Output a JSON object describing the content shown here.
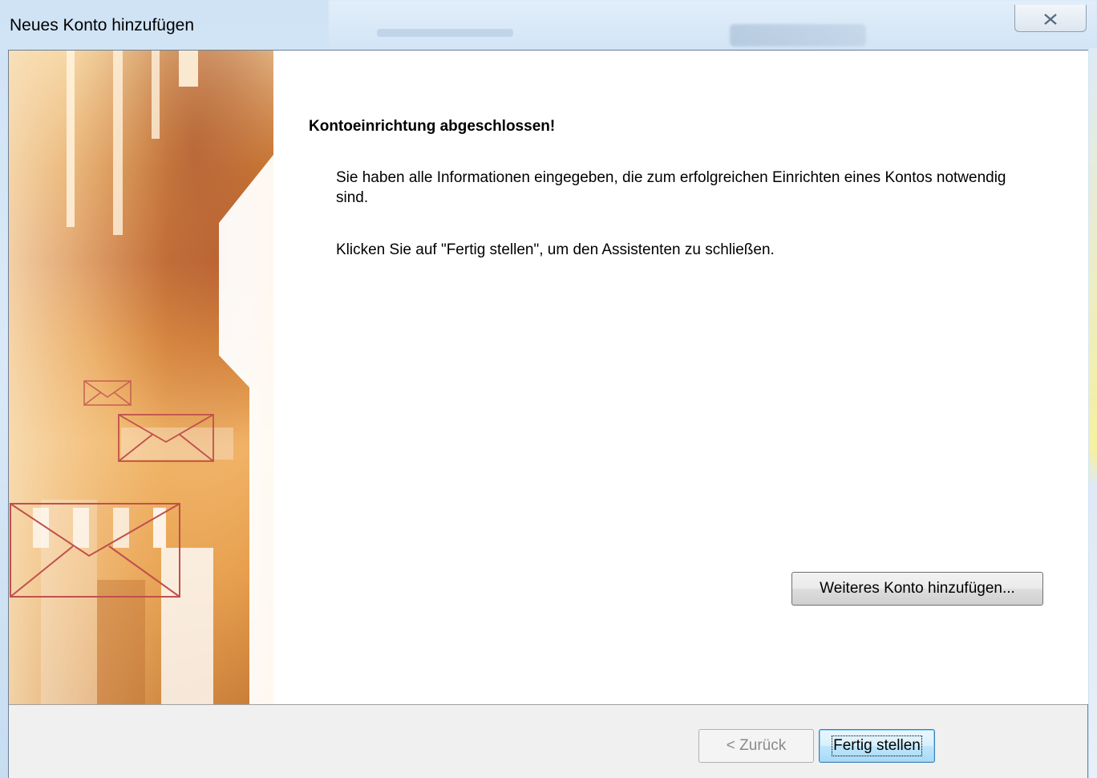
{
  "window": {
    "title": "Neues Konto hinzufügen"
  },
  "content": {
    "heading": "Kontoeinrichtung abgeschlossen!",
    "paragraph1": "Sie haben alle Informationen eingegeben, die zum erfolgreichen Einrichten eines Kontos notwendig sind.",
    "paragraph2": "Klicken Sie auf \"Fertig stellen\", um den Assistenten zu schließen."
  },
  "buttons": {
    "add_account": "Weiteres Konto hinzufügen...",
    "back": "< Zurück",
    "finish": "Fertig stellen"
  },
  "icons": {
    "close": "close-icon",
    "envelope": "envelope-icon"
  },
  "colors": {
    "banner_orange": "#d9762a",
    "banner_light": "#f7d9a8",
    "envelope_line": "#c0504d",
    "finish_button_border": "#3c7fb1"
  }
}
